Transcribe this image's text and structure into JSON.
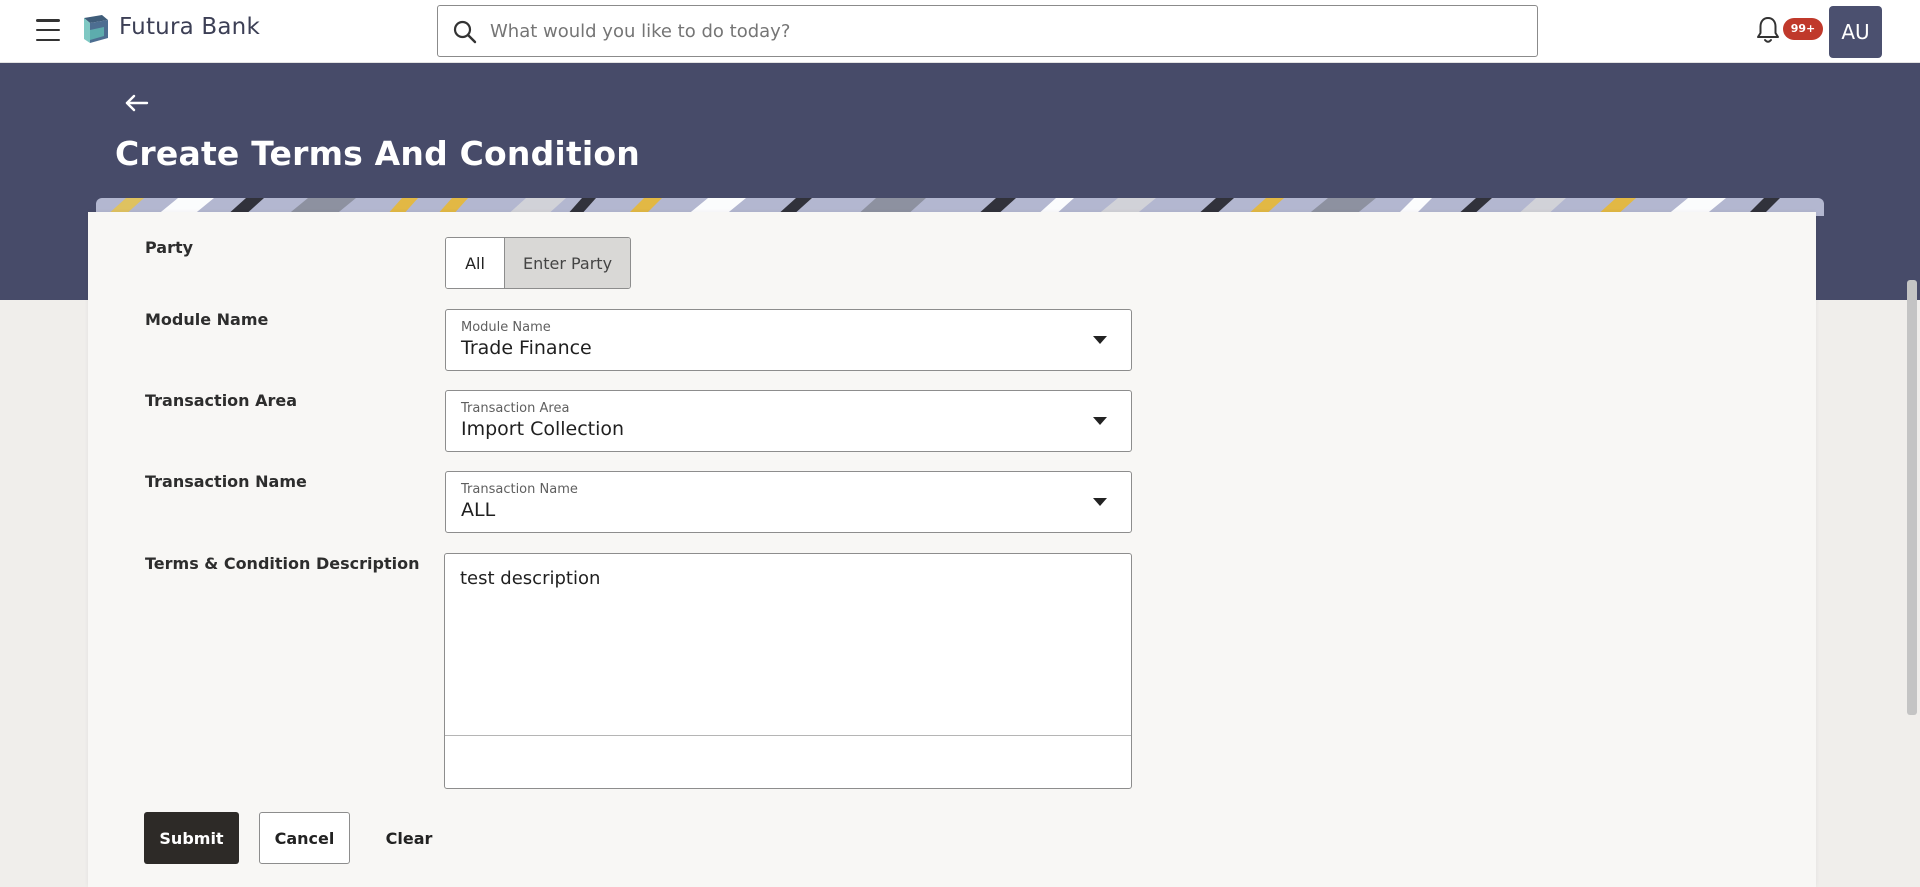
{
  "header": {
    "brand_name": "Futura Bank",
    "search_placeholder": "What would you like to do today?",
    "notification_count": "99+",
    "avatar_initials": "AU",
    "icons": {
      "menu": "hamburger-menu-icon",
      "logo": "futura-bank-logo",
      "search": "search-icon",
      "notifications": "bell-icon",
      "back": "back-arrow-icon",
      "dropdown": "caret-down-icon"
    }
  },
  "page": {
    "title": "Create Terms And Condition"
  },
  "form": {
    "party": {
      "label": "Party",
      "options": [
        "All",
        "Enter Party"
      ],
      "selected": "Enter Party"
    },
    "module_name": {
      "label": "Module Name",
      "float_label": "Module Name",
      "value": "Trade Finance"
    },
    "transaction_area": {
      "label": "Transaction Area",
      "float_label": "Transaction Area",
      "value": "Import Collection"
    },
    "transaction_name": {
      "label": "Transaction Name",
      "float_label": "Transaction Name",
      "value": "ALL"
    },
    "description": {
      "label": "Terms & Condition Description",
      "value": "test description"
    }
  },
  "actions": {
    "submit": "Submit",
    "cancel": "Cancel",
    "clear": "Clear"
  },
  "colors": {
    "banner": "#474b69",
    "avatar": "#4b506f",
    "badge": "#c0392b",
    "primary_button": "#2d2a27",
    "selected_toggle": "#d9d8d6"
  }
}
